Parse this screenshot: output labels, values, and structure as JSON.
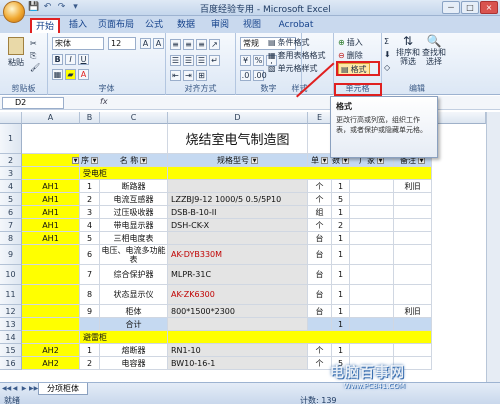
{
  "window": {
    "title": "百度经验专用 - Microsoft Excel",
    "controls": [
      "－",
      "□",
      "×"
    ]
  },
  "quick_access": [
    "💾",
    "↶",
    "↷",
    "▾"
  ],
  "tabs": [
    "开始",
    "插入",
    "页面布局",
    "公式",
    "数据",
    "审阅",
    "视图",
    "Acrobat"
  ],
  "ribbon": {
    "clipboard": {
      "paste": "粘贴",
      "label": "剪贴板"
    },
    "font": {
      "name": "宋体",
      "size": "12",
      "bold": "B",
      "italic": "I",
      "underline": "U",
      "grow": "A",
      "shrink": "A",
      "font_color": "A",
      "label": "字体"
    },
    "alignment": {
      "label": "对齐方式"
    },
    "number": {
      "format": "常规",
      "percent": "%",
      "comma": ",",
      "label": "数字"
    },
    "styles": {
      "conditional": "条件格式",
      "table": "套用表格格式",
      "cell": "单元格样式",
      "label": "样式"
    },
    "cells": {
      "insert": "插入",
      "delete": "删除",
      "format": "格式",
      "label": "单元格"
    },
    "editing": {
      "sort": "排序和\n筛选",
      "find": "查找和\n选择",
      "label": "编辑"
    }
  },
  "tooltip": {
    "title": "格式",
    "body": "更改行高或列宽，组织工作表，或者保护或隐藏单元格。"
  },
  "formula_bar": {
    "name_box": "D2",
    "fx": "fx"
  },
  "columns": [
    "A",
    "B",
    "C",
    "D",
    "E",
    "F",
    "G",
    "H"
  ],
  "rows": [
    {
      "num": "1",
      "a": "",
      "b": "",
      "c": "",
      "d": "烧结室电气制造图",
      "e": "",
      "f": "",
      "g": "",
      "h": ""
    },
    {
      "num": "2",
      "a": "",
      "b": "序",
      "c": "名  称",
      "d": "规格型号",
      "e": "单",
      "f": "数",
      "g": "厂家",
      "h": "备注"
    },
    {
      "num": "3",
      "a": "",
      "b": "受电柜",
      "c": "",
      "d": "",
      "e": "",
      "f": "",
      "g": "",
      "h": ""
    },
    {
      "num": "4",
      "a": "AH1",
      "b": "1",
      "c": "断路器",
      "d": "",
      "e": "个",
      "f": "1",
      "g": "",
      "h": "利旧"
    },
    {
      "num": "5",
      "a": "AH1",
      "b": "2",
      "c": "电流互感器",
      "d": "LZZBJ9-12  1000/5  0.5/5P10",
      "e": "个",
      "f": "5",
      "g": "",
      "h": ""
    },
    {
      "num": "6",
      "a": "AH1",
      "b": "3",
      "c": "过压吸收器",
      "d": "DSB-B-10-II",
      "e": "组",
      "f": "1",
      "g": "",
      "h": ""
    },
    {
      "num": "7",
      "a": "AH1",
      "b": "4",
      "c": "带电显示器",
      "d": "DSH-CK-X",
      "e": "个",
      "f": "2",
      "g": "",
      "h": ""
    },
    {
      "num": "8",
      "a": "AH1",
      "b": "5",
      "c": "三相电度表",
      "d": "",
      "e": "台",
      "f": "1",
      "g": "",
      "h": ""
    },
    {
      "num": "9",
      "a": "",
      "b": "6",
      "c": "电压、电流多功能表",
      "d": "AK-DYB330M",
      "e": "台",
      "f": "1",
      "g": "",
      "h": ""
    },
    {
      "num": "10",
      "a": "",
      "b": "7",
      "c": "综合保护器",
      "d": "MLPR-31C",
      "e": "台",
      "f": "1",
      "g": "",
      "h": ""
    },
    {
      "num": "11",
      "a": "",
      "b": "8",
      "c": "状态显示仪",
      "d": "AK-ZK6300",
      "e": "台",
      "f": "1",
      "g": "",
      "h": ""
    },
    {
      "num": "12",
      "a": "",
      "b": "9",
      "c": "柜体",
      "d": "800*1500*2300",
      "e": "台",
      "f": "1",
      "g": "",
      "h": "利旧"
    },
    {
      "num": "13",
      "a": "",
      "b": "",
      "c": "合计",
      "d": "",
      "e": "",
      "f": "1",
      "g": "",
      "h": ""
    },
    {
      "num": "14",
      "a": "",
      "b": "避雷柜",
      "c": "",
      "d": "",
      "e": "",
      "f": "",
      "g": "",
      "h": ""
    },
    {
      "num": "15",
      "a": "AH2",
      "b": "1",
      "c": "熔断器",
      "d": "RN1-10",
      "e": "个",
      "f": "1",
      "g": "",
      "h": ""
    },
    {
      "num": "16",
      "a": "AH2",
      "b": "2",
      "c": "电容器",
      "d": "BW10-16-1",
      "e": "个",
      "f": "5",
      "g": "",
      "h": ""
    }
  ],
  "sheet": {
    "tab": "分项柜体"
  },
  "status": {
    "ready": "就绪",
    "count": "计数: 139"
  },
  "watermark": {
    "main": "电脑百事网",
    "sub": "Www.PC841.COM"
  }
}
